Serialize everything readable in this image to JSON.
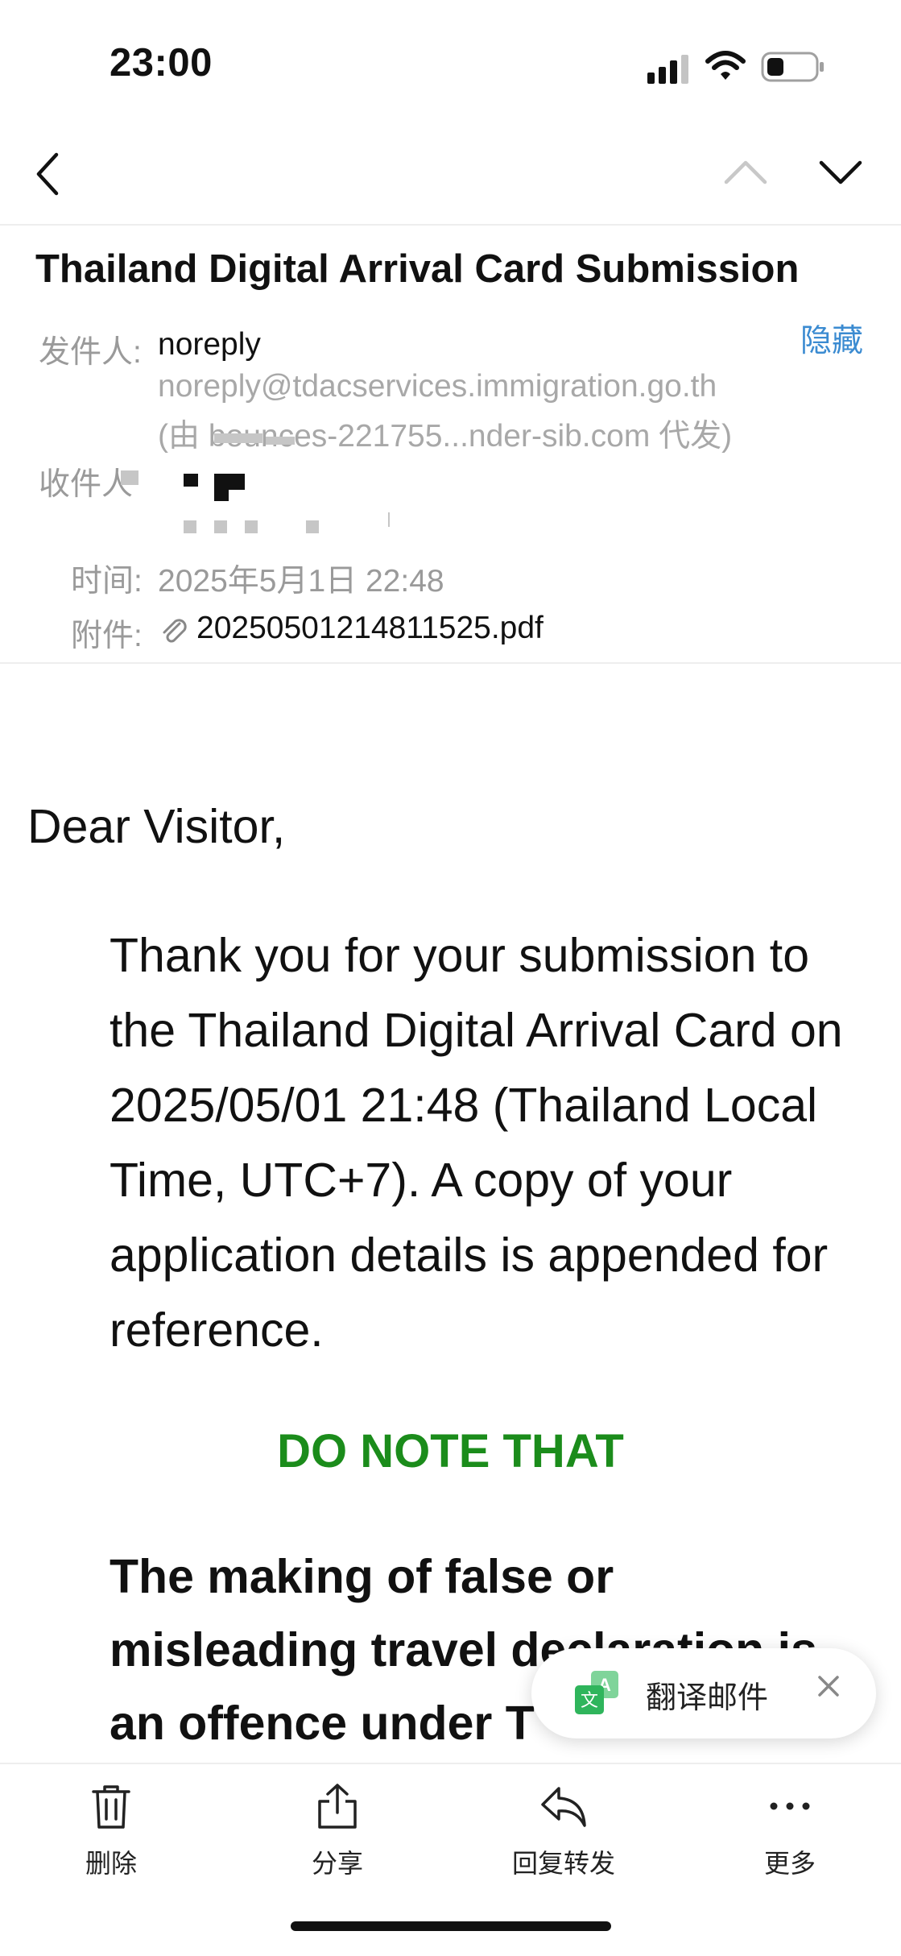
{
  "status_bar": {
    "time": "23:00"
  },
  "header": {
    "subject": "Thailand Digital Arrival Card Submission",
    "hide_link": "隐藏",
    "sender_label": "发件人:",
    "sender_name": "noreply",
    "sender_email": "noreply@tdacservices.immigration.go.th",
    "sender_via": "(由 bounces-221755...nder-sib.com 代发)",
    "recipient_label": "收件人",
    "time_label": "时间:",
    "time_value": "2025年5月1日 22:48",
    "attachment_label": "附件:",
    "attachment_file": "20250501214811525.pdf"
  },
  "body": {
    "greeting": "Dear Visitor,",
    "paragraph": "Thank you for your submission to the Thailand Digital Arrival Card on 2025/05/01 21:48 (Thailand Local Time, UTC+7). A copy of your application details is appended for reference.",
    "note_heading": "DO NOTE THAT",
    "warning": "The making of false or misleading travel declaration is an offence under T"
  },
  "translate_popup": {
    "label": "翻译邮件"
  },
  "toolbar": {
    "delete": "删除",
    "share": "分享",
    "reply_forward": "回复转发",
    "more": "更多"
  },
  "colors": {
    "link": "#3b8bd1",
    "note_green": "#1b8c1b",
    "label_gray": "#9a9a9a"
  },
  "icons": [
    "back-chevron-icon",
    "up-chevron-icon",
    "down-chevron-icon",
    "paperclip-icon",
    "translate-icon",
    "close-icon",
    "trash-icon",
    "share-icon",
    "reply-icon",
    "more-icon"
  ]
}
